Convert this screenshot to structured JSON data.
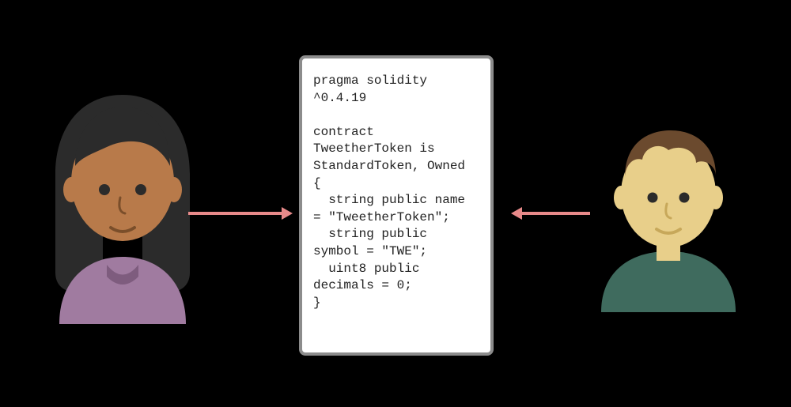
{
  "code": {
    "text": "pragma solidity ^0.4.19\n\ncontract TweetherToken is StandardToken, Owned {\n  string public name = \"TweetherToken\";\n  string public symbol = \"TWE\";\n  uint8 public decimals = 0;\n}"
  },
  "left_person": {
    "name": "woman-avatar"
  },
  "right_person": {
    "name": "man-avatar"
  },
  "arrows": {
    "left_to_center": "arrow-left-to-code",
    "right_to_center": "arrow-right-to-code"
  }
}
